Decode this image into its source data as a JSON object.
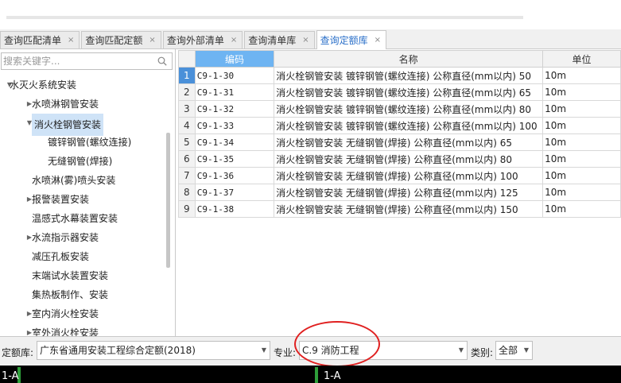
{
  "tabs": [
    {
      "label": "查询匹配清单",
      "active": false
    },
    {
      "label": "查询匹配定额",
      "active": false
    },
    {
      "label": "查询外部清单",
      "active": false
    },
    {
      "label": "查询清单库",
      "active": false
    },
    {
      "label": "查询定额库",
      "active": true
    }
  ],
  "tab_close_glyph": "×",
  "sidebar": {
    "search_placeholder": "搜索关键字...",
    "tree": [
      {
        "label": "水灭火系统安装",
        "arrow": "▼",
        "level": 0
      },
      {
        "label": "水喷淋钢管安装",
        "arrow": "▶",
        "level": 1
      },
      {
        "label": "消火栓钢管安装",
        "arrow": "▼",
        "level": 1,
        "selected": true
      },
      {
        "label": "镀锌钢管(螺纹连接)",
        "arrow": "",
        "level": 2
      },
      {
        "label": "无缝钢管(焊接)",
        "arrow": "",
        "level": 2
      },
      {
        "label": "水喷淋(雾)喷头安装",
        "arrow": "",
        "level": 1
      },
      {
        "label": "报警装置安装",
        "arrow": "▶",
        "level": 1
      },
      {
        "label": "温感式水幕装置安装",
        "arrow": "",
        "level": 1
      },
      {
        "label": "水流指示器安装",
        "arrow": "▶",
        "level": 1
      },
      {
        "label": "减压孔板安装",
        "arrow": "",
        "level": 1
      },
      {
        "label": "末端试水装置安装",
        "arrow": "",
        "level": 1
      },
      {
        "label": "集热板制作、安装",
        "arrow": "",
        "level": 1
      },
      {
        "label": "室内消火栓安装",
        "arrow": "▶",
        "level": 1
      },
      {
        "label": "室外消火栓安装",
        "arrow": "▶",
        "level": 1
      }
    ]
  },
  "grid": {
    "headers": {
      "code": "编码",
      "name": "名称",
      "unit": "单位"
    },
    "rows": [
      {
        "num": "1",
        "code": "C9-1-30",
        "name": "消火栓钢管安装 镀锌钢管(螺纹连接) 公称直径(mm以内) 50",
        "unit": "10m"
      },
      {
        "num": "2",
        "code": "C9-1-31",
        "name": "消火栓钢管安装 镀锌钢管(螺纹连接) 公称直径(mm以内) 65",
        "unit": "10m"
      },
      {
        "num": "3",
        "code": "C9-1-32",
        "name": "消火栓钢管安装 镀锌钢管(螺纹连接) 公称直径(mm以内) 80",
        "unit": "10m"
      },
      {
        "num": "4",
        "code": "C9-1-33",
        "name": "消火栓钢管安装 镀锌钢管(螺纹连接) 公称直径(mm以内) 100",
        "unit": "10m"
      },
      {
        "num": "5",
        "code": "C9-1-34",
        "name": "消火栓钢管安装 无缝钢管(焊接) 公称直径(mm以内) 65",
        "unit": "10m"
      },
      {
        "num": "6",
        "code": "C9-1-35",
        "name": "消火栓钢管安装 无缝钢管(焊接) 公称直径(mm以内) 80",
        "unit": "10m"
      },
      {
        "num": "7",
        "code": "C9-1-36",
        "name": "消火栓钢管安装 无缝钢管(焊接) 公称直径(mm以内) 100",
        "unit": "10m"
      },
      {
        "num": "8",
        "code": "C9-1-37",
        "name": "消火栓钢管安装 无缝钢管(焊接) 公称直径(mm以内) 125",
        "unit": "10m"
      },
      {
        "num": "9",
        "code": "C9-1-38",
        "name": "消火栓钢管安装 无缝钢管(焊接) 公称直径(mm以内) 150",
        "unit": "10m"
      }
    ],
    "selected_row": 0
  },
  "bottom": {
    "library_label": "定额库:",
    "library_value": "广东省通用安装工程综合定额(2018)",
    "specialty_label": "专业:",
    "specialty_value": "C.9 消防工程",
    "category_label": "类别:",
    "category_value": "全部",
    "caret": "▼"
  },
  "status_strip": {
    "left": "1-A",
    "right": "1-A"
  },
  "colors": {
    "accent": "#2a6fc9",
    "header_blue": "#6eb4f2",
    "selection": "#cfe3f7",
    "annotation_red": "#e02020"
  }
}
